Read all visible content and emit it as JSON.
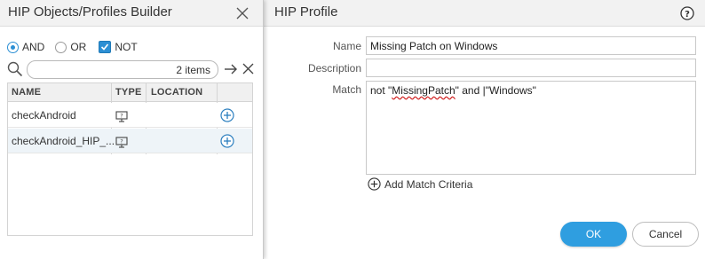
{
  "builder": {
    "title": "HIP Objects/Profiles Builder",
    "filters": {
      "and_label": "AND",
      "or_label": "OR",
      "not_label": "NOT"
    },
    "search": {
      "value": "",
      "count": "2 items"
    },
    "columns": [
      "NAME",
      "TYPE",
      "LOCATION"
    ],
    "rows": [
      {
        "name": "checkAndroid",
        "location": ""
      },
      {
        "name": "checkAndroid_HIP_...",
        "location": ""
      }
    ]
  },
  "profile": {
    "title": "HIP Profile",
    "name_label": "Name",
    "name_value": "Missing Patch on Windows",
    "description_label": "Description",
    "description_value": "",
    "match_label": "Match",
    "match_parts": {
      "before": "not \"",
      "underlined": "MissingPatch",
      "after": "\" and |\"Windows\""
    },
    "add_criteria_label": "Add Match Criteria",
    "ok_label": "OK",
    "cancel_label": "Cancel"
  },
  "colors": {
    "accent": "#2c8fd4",
    "ok_button": "#2f9ee0",
    "selected_row": "#eef4f8"
  }
}
